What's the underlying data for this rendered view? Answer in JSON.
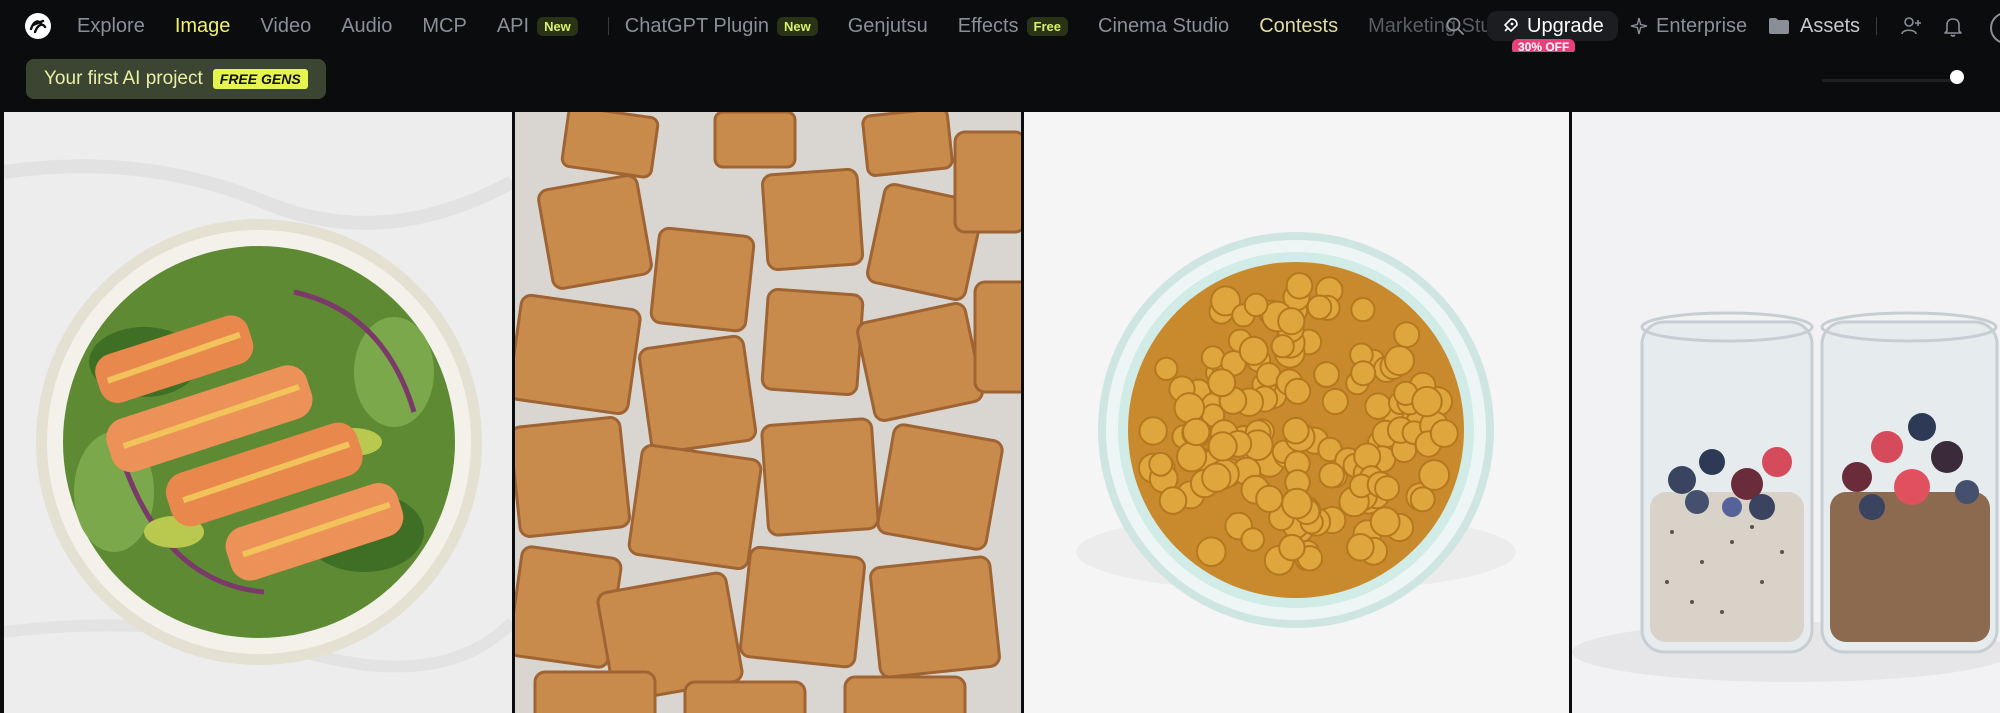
{
  "nav": {
    "items": [
      {
        "label": "Explore"
      },
      {
        "label": "Image"
      },
      {
        "label": "Video"
      },
      {
        "label": "Audio"
      },
      {
        "label": "MCP"
      },
      {
        "label": "API",
        "badge": "New"
      },
      {
        "label": "ChatGPT Plugin",
        "badge": "New"
      },
      {
        "label": "Genjutsu"
      },
      {
        "label": "Effects",
        "badge": "Free"
      },
      {
        "label": "Cinema Studio"
      },
      {
        "label": "Contests"
      },
      {
        "label": "Marketing Studio"
      },
      {
        "label": "Su"
      }
    ],
    "active_item": "Image"
  },
  "actions": {
    "upgrade_label": "Upgrade",
    "upgrade_discount": "30% OFF",
    "enterprise_label": "Enterprise",
    "assets_label": "Assets"
  },
  "subbar": {
    "project_label": "Your first AI project",
    "free_badge": "FREE GENS"
  },
  "icons": {
    "logo": "logo-icon",
    "search": "search-icon",
    "rocket": "rocket-icon",
    "sparkle": "sparkle-icon",
    "folder": "folder-icon",
    "add_user": "add-user-icon",
    "bell": "bell-icon"
  },
  "colors": {
    "background": "#0b0c0e",
    "active_nav": "#f2f06a",
    "badge_text": "#d8f06a",
    "discount": "#e8407a",
    "free_gens": "#e6f44e"
  },
  "gallery": {
    "tiles": [
      {
        "name": "salmon-salad-image"
      },
      {
        "name": "tofu-cubes-image"
      },
      {
        "name": "chickpeas-bowl-image"
      },
      {
        "name": "overnight-oats-image"
      }
    ]
  }
}
